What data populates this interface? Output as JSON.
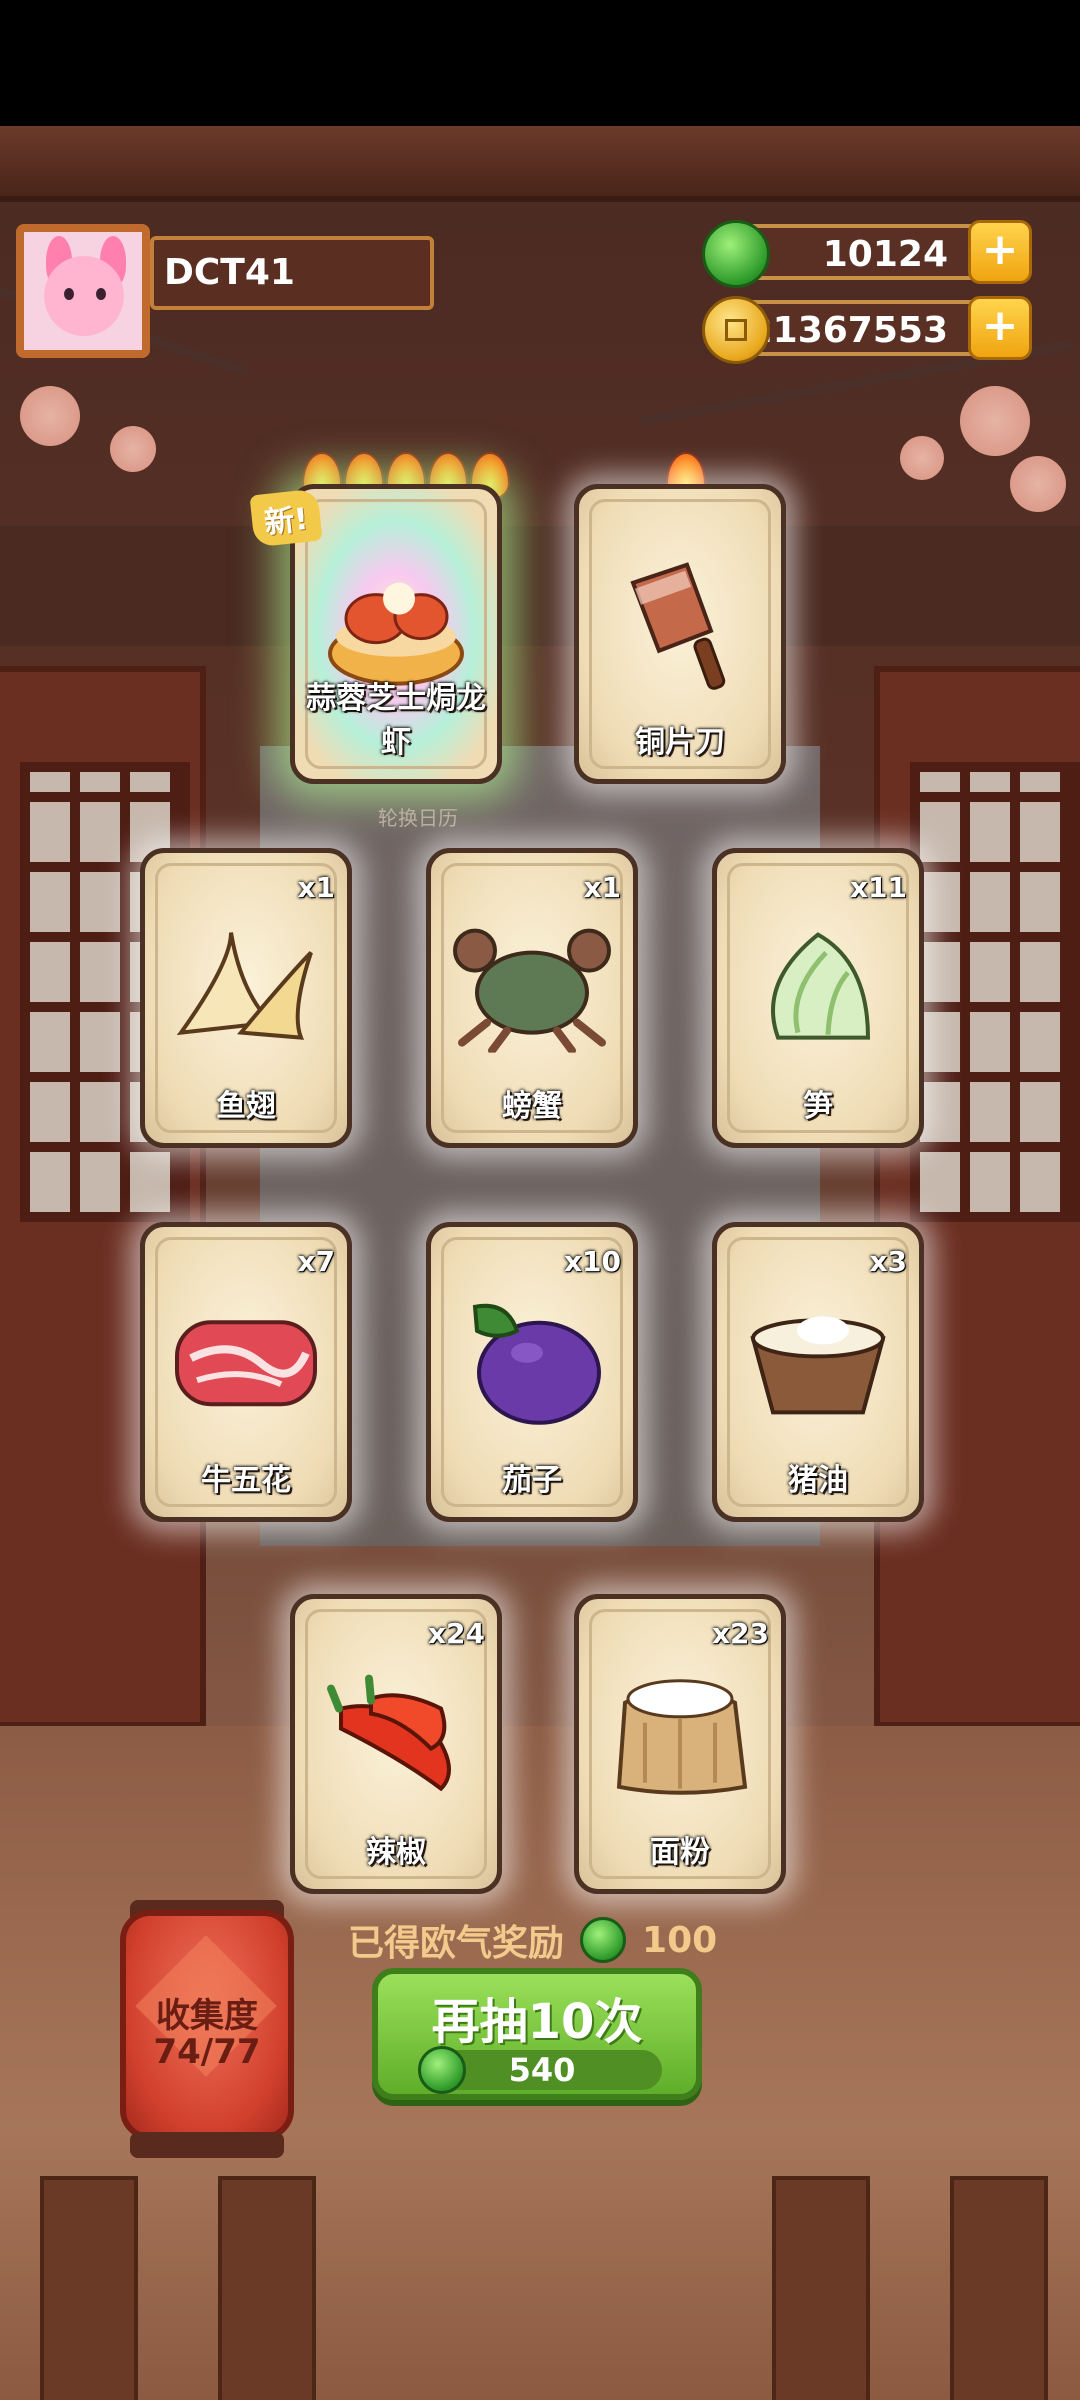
{
  "player": {
    "name": "DCT41"
  },
  "currencies": {
    "jade": {
      "value": "10124",
      "icon": "green-jade-coin-icon"
    },
    "gold": {
      "value": "21367553",
      "icon": "gold-coin-icon"
    }
  },
  "featured": [
    {
      "label": "蒜蓉芝士焗龙虾",
      "stars": 5,
      "new_badge": "新!",
      "icon": "lobster-dish-icon"
    },
    {
      "label": "铜片刀",
      "stars": 1,
      "icon": "cleaver-icon"
    }
  ],
  "calendar_text": "轮换日历",
  "ingredients": [
    {
      "label": "鱼翅",
      "qty": "x1",
      "icon": "shark-fin-icon"
    },
    {
      "label": "螃蟹",
      "qty": "x1",
      "icon": "crab-icon"
    },
    {
      "label": "笋",
      "qty": "x11",
      "icon": "bamboo-shoot-icon"
    },
    {
      "label": "牛五花",
      "qty": "x7",
      "icon": "beef-icon"
    },
    {
      "label": "茄子",
      "qty": "x10",
      "icon": "eggplant-icon"
    },
    {
      "label": "猪油",
      "qty": "x3",
      "icon": "lard-icon"
    },
    {
      "label": "辣椒",
      "qty": "x24",
      "icon": "chili-icon"
    },
    {
      "label": "面粉",
      "qty": "x23",
      "icon": "flour-sack-icon"
    }
  ],
  "reward": {
    "label": "已得欧气奖励",
    "value": "100"
  },
  "draw_button": {
    "title": "再抽10次",
    "cost": "540"
  },
  "collection": {
    "label": "收集度",
    "progress": "74/77"
  }
}
